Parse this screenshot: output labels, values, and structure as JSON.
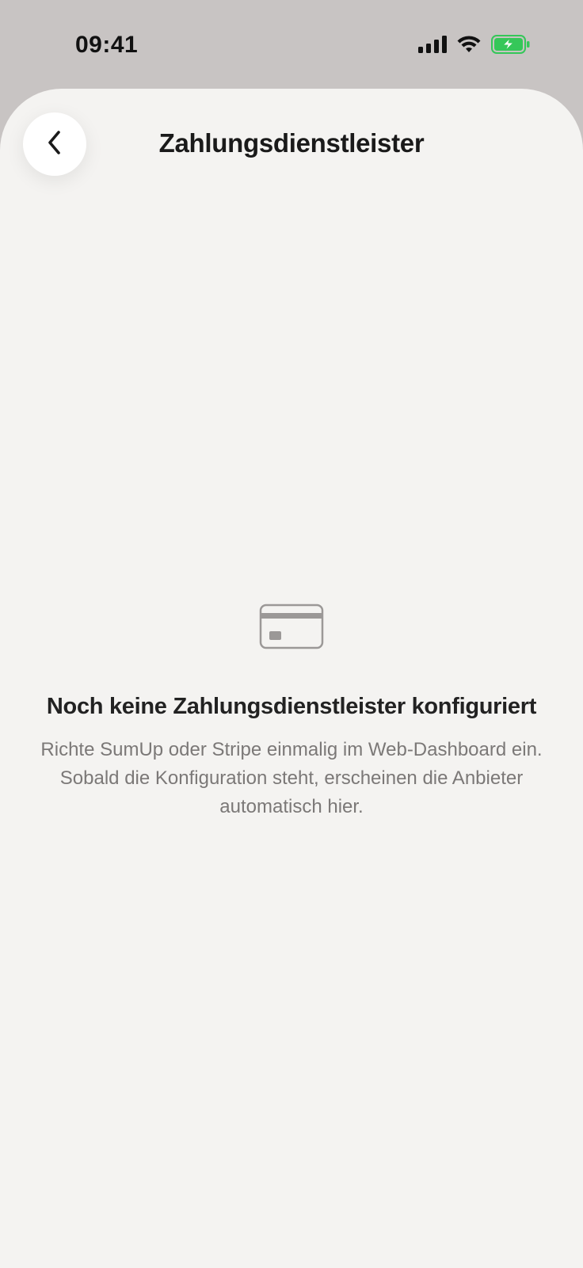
{
  "status_bar": {
    "time": "09:41",
    "icons": [
      "signal-icon",
      "wifi-icon",
      "battery-charging-icon"
    ],
    "battery_color": "#35c759"
  },
  "header": {
    "back_icon": "chevron-left-icon",
    "title": "Zahlungsdienstleister"
  },
  "empty_state": {
    "icon": "credit-card-icon",
    "heading": "Noch keine Zahlungsdienstleister konfiguriert",
    "body": "Richte SumUp oder Stripe einmalig im Web-Dashboard ein. Sobald die Konfiguration steht, erscheinen die Anbieter automatisch hier."
  },
  "colors": {
    "status_background": "#c8c4c3",
    "sheet_background": "#f4f3f1",
    "text_primary": "#1a1a1a",
    "text_secondary": "#7b7877",
    "icon_gray": "#9b9897"
  }
}
